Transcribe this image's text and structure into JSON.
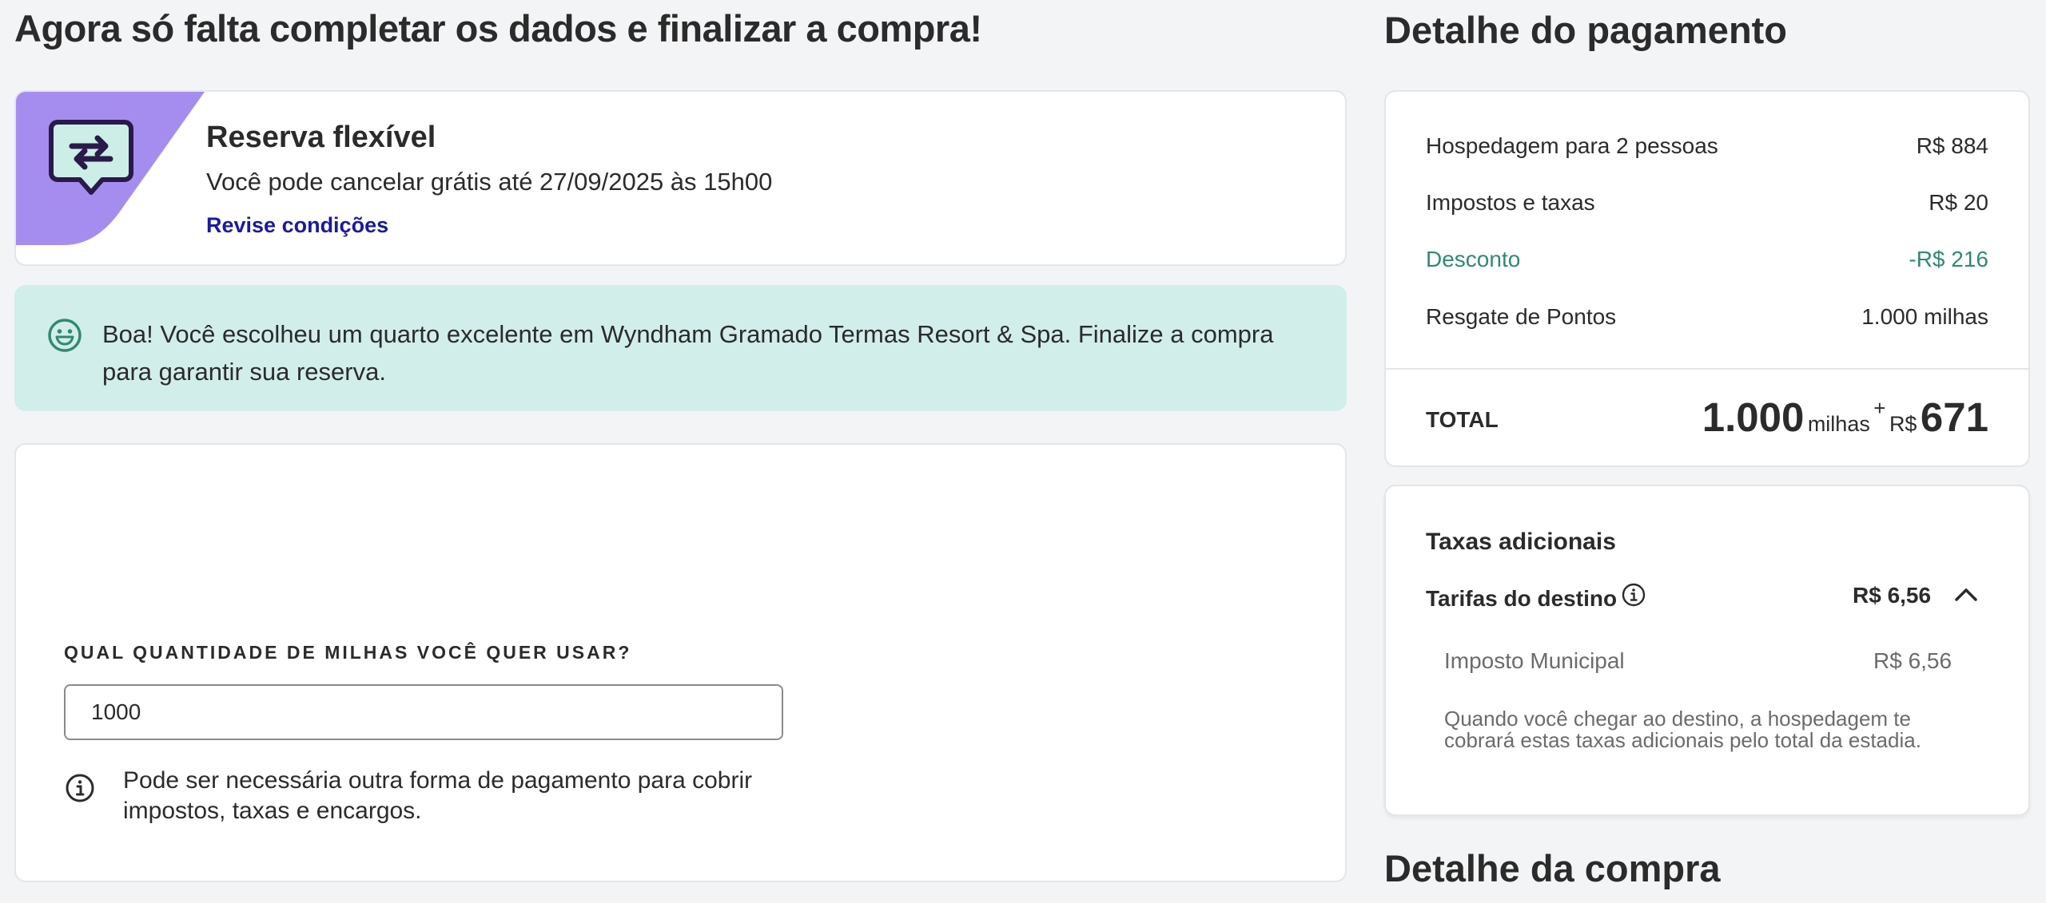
{
  "page": {
    "title": "Agora só falta completar os dados e finalizar a compra!"
  },
  "flexible_booking": {
    "title": "Reserva flexível",
    "subtitle": "Você pode cancelar grátis até 27/09/2025 às 15h00",
    "link_label": "Revise condições",
    "icon": "refresh-chat-icon",
    "ribbon_color": "#a58df0"
  },
  "notice": {
    "icon": "smile-icon",
    "text": "Boa! Você escolheu um quarto excelente em Wyndham Gramado Termas Resort & Spa. Finalize a compra para garantir sua reserva.",
    "background": "#d2eeea"
  },
  "miles": {
    "label": "QUAL QUANTIDADE DE MILHAS VOCÊ QUER USAR?",
    "value": "1000",
    "info_icon": "info-icon",
    "note": "Pode ser necessária outra forma de pagamento para cobrir impostos, taxas e encargos."
  },
  "payment": {
    "title": "Detalhe do pagamento",
    "rows": [
      {
        "label": "Hospedagem para 2 pessoas",
        "value": "R$ 884"
      },
      {
        "label": "Impostos e taxas",
        "value": "R$ 20"
      },
      {
        "label": "Desconto",
        "value": "-R$ 216"
      },
      {
        "label": "Resgate de Pontos",
        "value": "1.000 milhas"
      }
    ],
    "discount_color": "#2f8a72",
    "total": {
      "label": "TOTAL",
      "miles": "1.000",
      "miles_unit": "milhas",
      "plus": "+",
      "currency": "R$",
      "amount": "671"
    }
  },
  "fees": {
    "title": "Taxas adicionais",
    "destination_label": "Tarifas do destino",
    "destination_value": "R$ 6,56",
    "chevron_icon": "chevron-up-icon",
    "tax_label": "Imposto Municipal",
    "tax_value": "R$ 6,56",
    "note": "Quando você chegar ao destino, a hospedagem te cobrará estas taxas adicionais pelo total da estadia."
  },
  "purchase": {
    "title": "Detalhe da compra"
  }
}
